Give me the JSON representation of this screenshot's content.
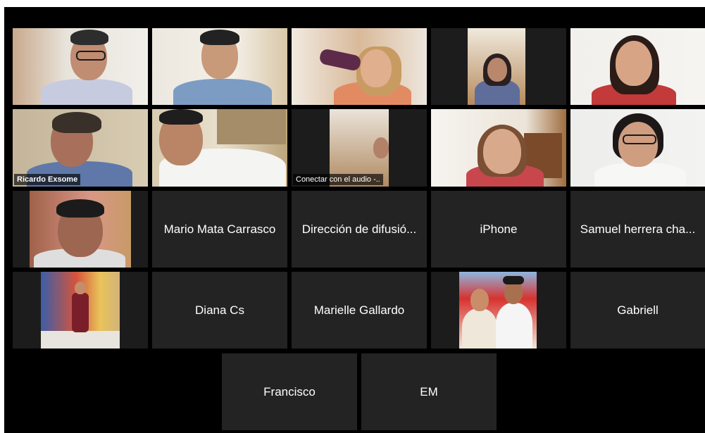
{
  "meeting": {
    "colors": {
      "background": "#000000",
      "tile": "#232323",
      "active_speaker_border": "#b9d66a",
      "name_text": "#ffffff"
    },
    "participants": [
      {
        "id": "p01",
        "name": "",
        "type": "video"
      },
      {
        "id": "p02",
        "name": "",
        "type": "video"
      },
      {
        "id": "p03",
        "name": "",
        "type": "video"
      },
      {
        "id": "p04",
        "name": "",
        "type": "video"
      },
      {
        "id": "p05",
        "name": "",
        "type": "video"
      },
      {
        "id": "p06",
        "name": "Ricardo Exsome",
        "type": "video",
        "active_speaker": true
      },
      {
        "id": "p07",
        "name": "",
        "type": "video"
      },
      {
        "id": "p08",
        "name": "Conectar con el audio -..",
        "type": "video"
      },
      {
        "id": "p09",
        "name": "",
        "type": "video"
      },
      {
        "id": "p10",
        "name": "",
        "type": "video"
      },
      {
        "id": "p11",
        "name": "",
        "type": "video"
      },
      {
        "id": "p12",
        "name": "Mario Mata Carrasco",
        "type": "name-only"
      },
      {
        "id": "p13",
        "name": "Dirección de difusió...",
        "type": "name-only"
      },
      {
        "id": "p14",
        "name": "iPhone",
        "type": "name-only"
      },
      {
        "id": "p15",
        "name": "Samuel herrera cha...",
        "type": "name-only"
      },
      {
        "id": "p16",
        "name": "",
        "type": "video"
      },
      {
        "id": "p17",
        "name": "Diana Cs",
        "type": "name-only"
      },
      {
        "id": "p18",
        "name": "Marielle Gallardo",
        "type": "name-only"
      },
      {
        "id": "p19",
        "name": "",
        "type": "video"
      },
      {
        "id": "p20",
        "name": "Gabriell",
        "type": "name-only"
      },
      {
        "id": "p21",
        "name": "Francisco",
        "type": "name-only"
      },
      {
        "id": "p22",
        "name": "EM",
        "type": "name-only"
      }
    ]
  }
}
